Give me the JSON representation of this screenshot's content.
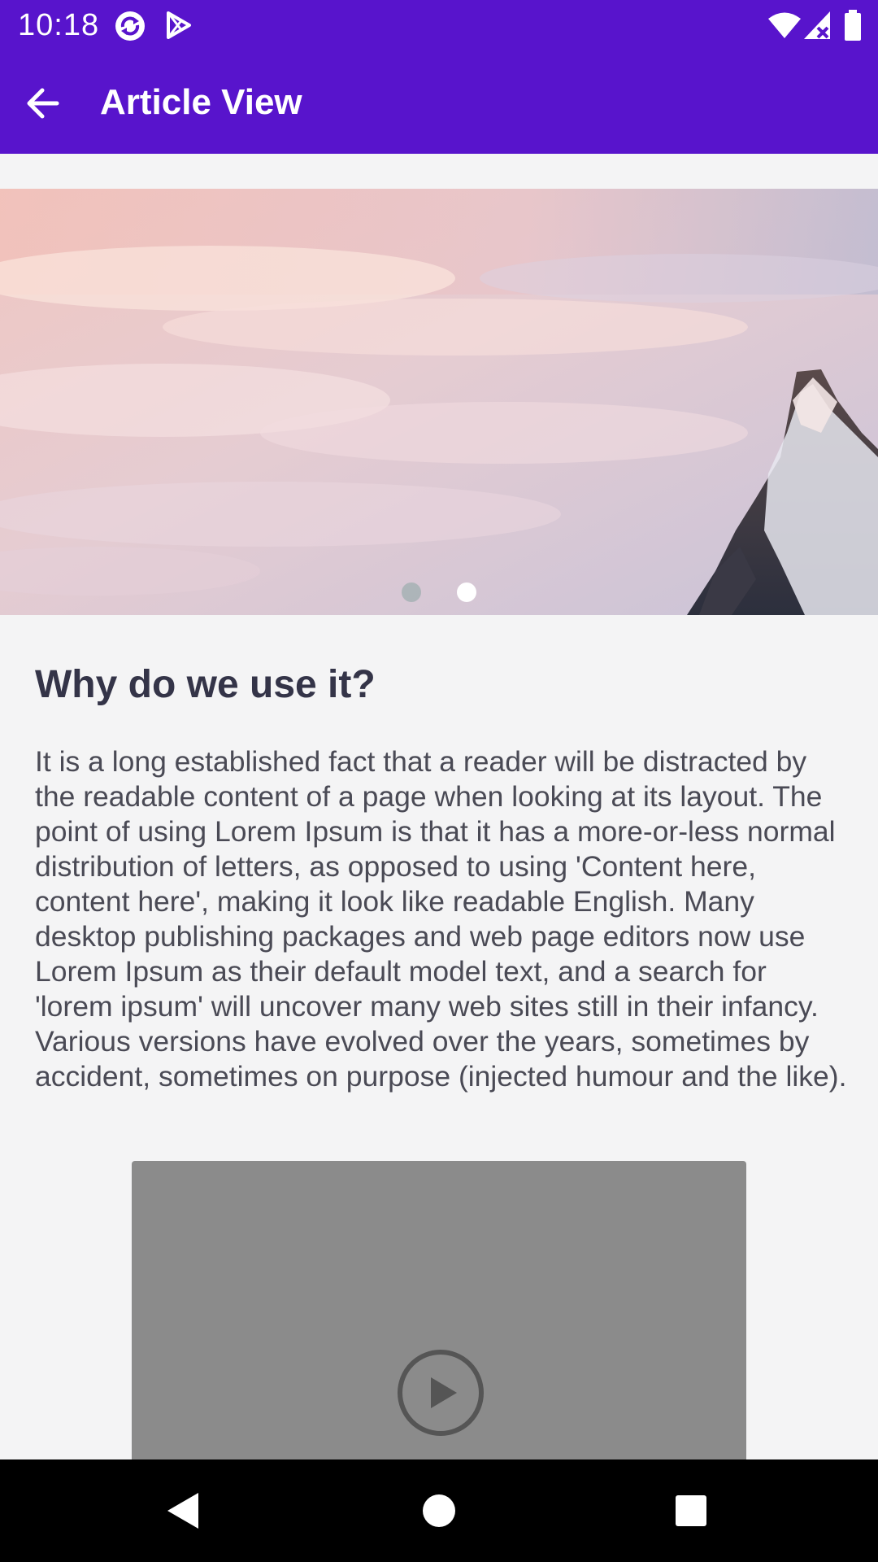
{
  "status_bar": {
    "time": "10:18",
    "icons": [
      "sync-icon",
      "play-store-icon",
      "wifi-icon",
      "signal-icon",
      "battery-icon"
    ]
  },
  "app_bar": {
    "back_icon": "arrow-back-icon",
    "title": "Article View"
  },
  "carousel": {
    "pages": 2,
    "active_page": 2
  },
  "article": {
    "title": "Why do we use it?",
    "body": "It is a long established fact that a reader will be distracted by the readable content of a page when looking at its layout. The point of using Lorem Ipsum is that it has a more-or-less normal distribution of letters, as opposed to using 'Content here, content here', making it look like readable English. Many desktop publishing packages and web page editors now use Lorem Ipsum as their default model text, and a search for 'lorem ipsum' will uncover many web sites still in their infancy. Various versions have evolved over the years, sometimes by accident, sometimes on purpose (injected humour and the like)."
  },
  "video": {
    "play_icon": "play-circle-icon"
  },
  "nav_bar": {
    "buttons": [
      "back-triangle-icon",
      "home-circle-icon",
      "recents-square-icon"
    ]
  },
  "colors": {
    "primary": "#5814cc",
    "background": "#f4f4f5",
    "title_text": "#343448",
    "body_text": "#4a4a55",
    "video_placeholder": "#8b8b8b"
  }
}
